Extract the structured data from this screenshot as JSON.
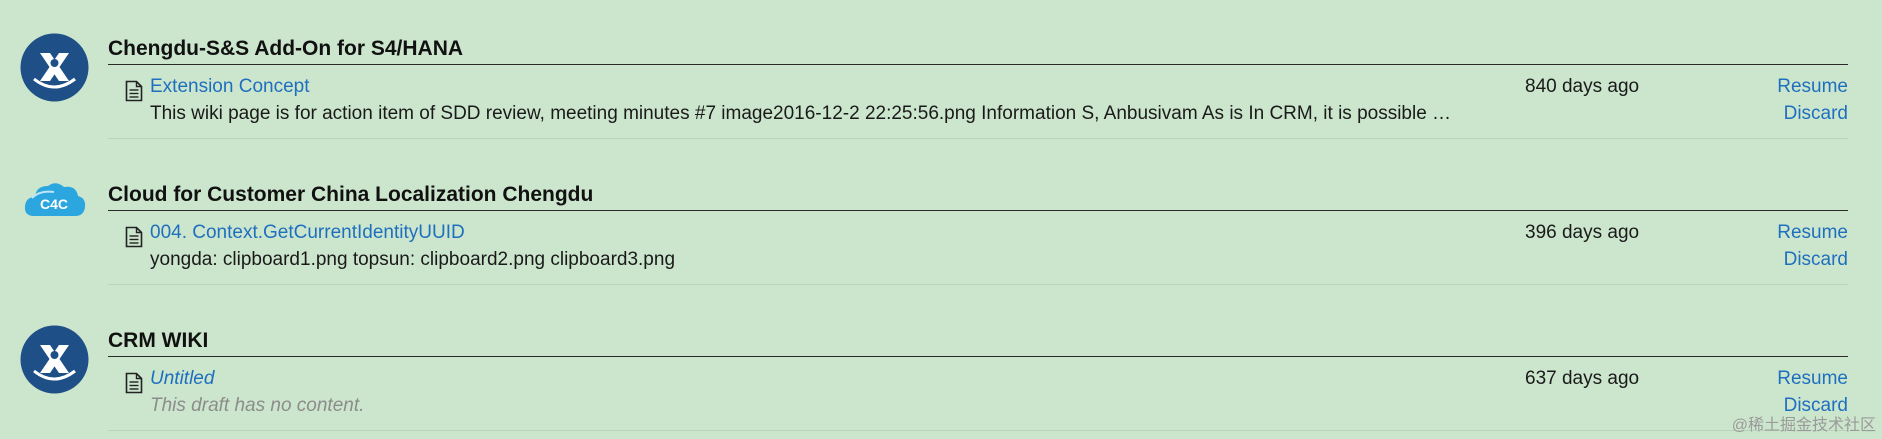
{
  "spaces": [
    {
      "title": "Chengdu-S&S Add-On for S4/HANA",
      "avatar_icon": "confluence-space-icon",
      "draft": {
        "title": "Extension Concept",
        "excerpt": "This wiki page is for action item of SDD review, meeting minutes #7 image2016-12-2 22:25:56.png Information S, Anbusivam As is In CRM, it is possible …",
        "age": "840 days ago",
        "resume_label": "Resume",
        "discard_label": "Discard"
      }
    },
    {
      "title": "Cloud for Customer China Localization Chengdu",
      "avatar_icon": "c4c-cloud-icon",
      "avatar_text": "C4C",
      "draft": {
        "title": "004. Context.GetCurrentIdentityUUID",
        "excerpt": "yongda: clipboard1.png topsun: clipboard2.png clipboard3.png",
        "age": "396 days ago",
        "resume_label": "Resume",
        "discard_label": "Discard"
      }
    },
    {
      "title": "CRM WIKI",
      "avatar_icon": "confluence-space-icon",
      "draft": {
        "title": "Untitled",
        "excerpt": "This draft has no content.",
        "age": "637 days ago",
        "resume_label": "Resume",
        "discard_label": "Discard"
      }
    }
  ],
  "watermark": "@稀土掘金技术社区",
  "colors": {
    "background": "#cce6cd",
    "link": "#1f6fbf",
    "avatar": "#1e4f86"
  }
}
